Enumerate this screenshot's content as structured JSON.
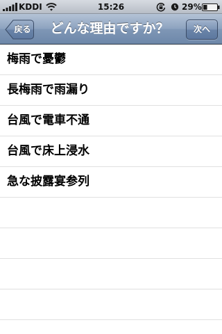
{
  "status_bar": {
    "carrier": "KDDI",
    "time": "15:26",
    "battery_percent": "29%",
    "battery_level": 0.29,
    "icons": [
      "signal-bars-icon",
      "wifi-icon",
      "rotation-lock-icon",
      "alarm-icon",
      "battery-icon"
    ]
  },
  "nav": {
    "title": "どんな理由ですか？",
    "back_label": "戻る",
    "next_label": "次へ"
  },
  "reasons": [
    "梅雨で憂鬱",
    "長梅雨で雨漏り",
    "台風で電車不通",
    "台風で床上浸水",
    "急な披露宴参列"
  ],
  "colors": {
    "nav_bar": "#7f97b6",
    "separator": "#e0e0e0",
    "text": "#000000"
  }
}
